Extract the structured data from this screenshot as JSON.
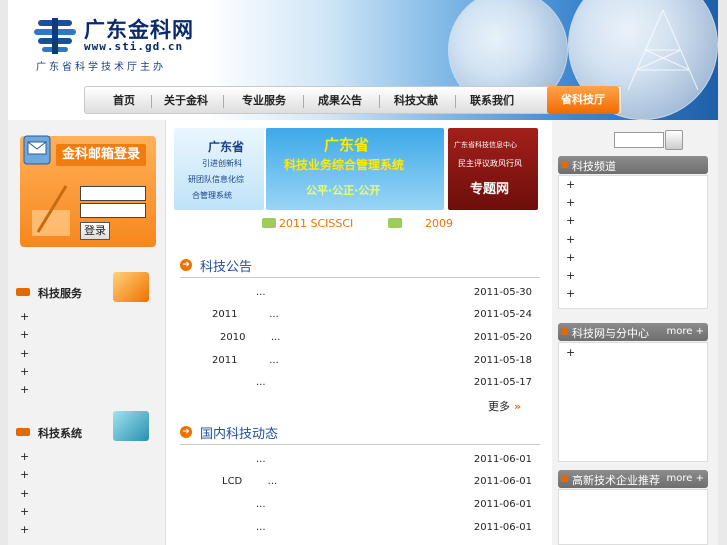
{
  "header": {
    "site_title": "广东金科网",
    "site_url": "www.sti.gd.cn",
    "site_subtitle": "广东省科学技术厅主办"
  },
  "nav": {
    "items": [
      "首页",
      "关于金科",
      "专业服务",
      "成果公告",
      "科技文献",
      "联系我们"
    ],
    "active_item": "省科技厅"
  },
  "login": {
    "title": "金科邮箱登录",
    "button": "登录"
  },
  "left": {
    "service_title": "科技服务",
    "service_items": [
      "+",
      "+",
      "+",
      "+",
      "+"
    ],
    "system_title": "科技系统",
    "system_items": [
      "+",
      "+",
      "+",
      "+",
      "+"
    ]
  },
  "banners": {
    "b1_line1": "广东省",
    "b1_line2": "引进创新科",
    "b1_line3": "研团队信息化综",
    "b1_line4": "合管理系统",
    "b2_line1": "广东省",
    "b2_line2": "科技业务综合管理系统",
    "b2_line3": "公平·公正·公开",
    "b3_line1": "广东省科技信息中心",
    "b3_line2": "民主评议政风行风",
    "b3_line3": "专题网"
  },
  "promos": [
    "2011 SCISSCI",
    "2009"
  ],
  "announcements": {
    "title": "科技公告",
    "rows": [
      {
        "text": "...",
        "date": "2011-05-30"
      },
      {
        "text": "2011          ...",
        "date": "2011-05-24"
      },
      {
        "text": "2010        ...",
        "date": "2011-05-20"
      },
      {
        "text": "2011          ...",
        "date": "2011-05-18"
      },
      {
        "text": "...",
        "date": "2011-05-17"
      }
    ],
    "more": "更多"
  },
  "domestic": {
    "title": "国内科技动态",
    "rows": [
      {
        "text": "...",
        "date": "2011-06-01"
      },
      {
        "text": "LCD        ...",
        "date": "2011-06-01"
      },
      {
        "text": "...",
        "date": "2011-06-01"
      },
      {
        "text": "...",
        "date": "2011-06-01"
      }
    ]
  },
  "right": {
    "channel_title": "科技频道",
    "channel_items": [
      "+",
      "+",
      "+",
      "+",
      "+",
      "+",
      "+"
    ],
    "branch_title": "科技网与分中心",
    "branch_more": "more +",
    "branch_items": [
      "+"
    ],
    "hightech_title": "高新技术企业推荐",
    "hightech_more": "more +"
  },
  "colors": {
    "accent": "#f07000",
    "link_blue": "#1f4f9a",
    "nav_active": "#f06a00"
  }
}
